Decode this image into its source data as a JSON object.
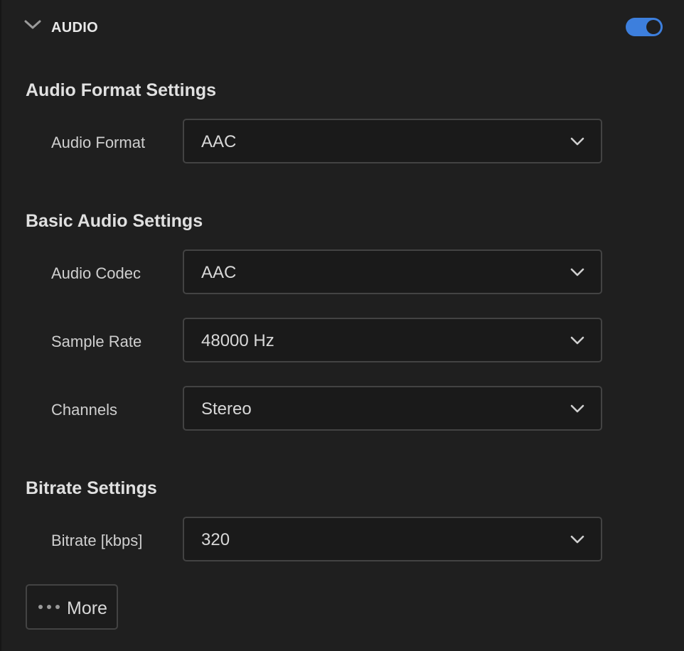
{
  "header": {
    "title": "AUDIO",
    "enabled": true,
    "accent_color": "#3d7fdd",
    "collapse_icon": "chevron-down-icon"
  },
  "groups": {
    "format": {
      "title": "Audio Format Settings",
      "rows": [
        {
          "label": "Audio Format",
          "value": "AAC"
        }
      ]
    },
    "basic": {
      "title": "Basic Audio Settings",
      "rows": [
        {
          "label": "Audio Codec",
          "value": "AAC"
        },
        {
          "label": "Sample Rate",
          "value": "48000 Hz"
        },
        {
          "label": "Channels",
          "value": "Stereo"
        }
      ]
    },
    "bitrate": {
      "title": "Bitrate Settings",
      "rows": [
        {
          "label": "Bitrate [kbps]",
          "value": "320"
        }
      ]
    }
  },
  "more_button": {
    "label": "More",
    "icon": "more-dots-icon"
  }
}
